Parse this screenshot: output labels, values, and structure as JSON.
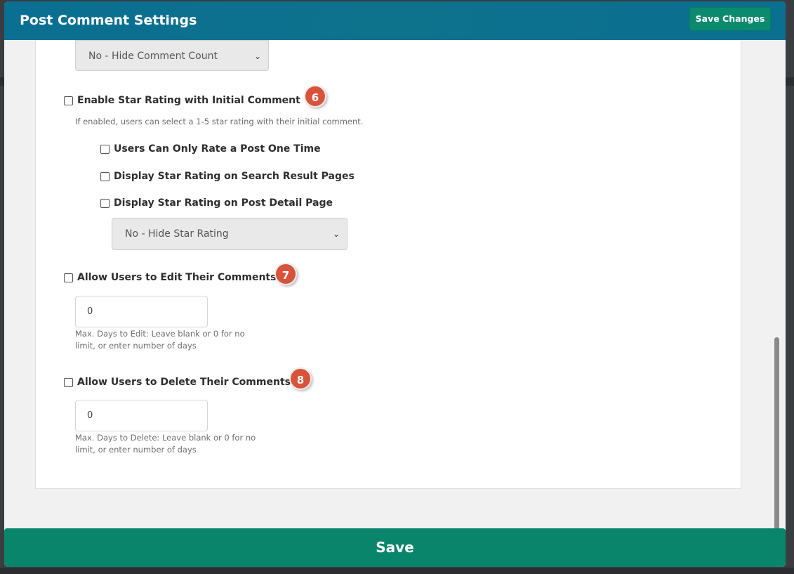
{
  "header": {
    "title": "Post Comment Settings",
    "save_changes_label": "Save Changes"
  },
  "comment_count_select": {
    "selected": "No - Hide Comment Count"
  },
  "star_rating": {
    "label": "Enable Star Rating with Initial Comment",
    "badge": "6",
    "help": "If enabled, users can select a 1-5 star rating with their initial comment.",
    "options": [
      {
        "label": "Users Can Only Rate a Post One Time"
      },
      {
        "label": "Display Star Rating on Search Result Pages"
      },
      {
        "label": "Display Star Rating on Post Detail Page"
      }
    ],
    "detail_select": {
      "selected": "No - Hide Star Rating"
    }
  },
  "edit_comments": {
    "label": "Allow Users to Edit Their Comments",
    "badge": "7",
    "value": "0",
    "help_line1": "Max. Days to Edit: Leave blank or 0 for no",
    "help_line2": "limit, or enter number of days"
  },
  "delete_comments": {
    "label": "Allow Users to Delete Their Comments",
    "badge": "8",
    "value": "0",
    "help_line1": "Max. Days to Delete: Leave blank or 0 for no",
    "help_line2": "limit, or enter number of days"
  },
  "footer": {
    "save_label": "Save"
  },
  "colors": {
    "header": "#0a6f91",
    "accent_green": "#08856b",
    "badge": "#d8533c"
  },
  "icons": {
    "select_chevron": "chevron-down-icon"
  }
}
